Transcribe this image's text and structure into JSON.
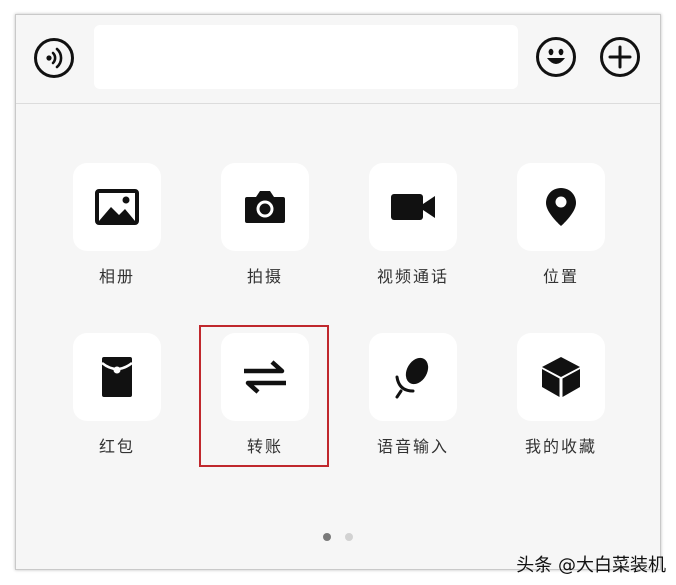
{
  "input": {
    "placeholder": ""
  },
  "actions": [
    {
      "label": "相册",
      "icon": "photo-album-icon"
    },
    {
      "label": "拍摄",
      "icon": "camera-icon"
    },
    {
      "label": "视频通话",
      "icon": "video-call-icon"
    },
    {
      "label": "位置",
      "icon": "location-pin-icon"
    },
    {
      "label": "红包",
      "icon": "red-packet-icon"
    },
    {
      "label": "转账",
      "icon": "transfer-icon"
    },
    {
      "label": "语音输入",
      "icon": "microphone-icon"
    },
    {
      "label": "我的收藏",
      "icon": "favorites-box-icon"
    }
  ],
  "pager": {
    "pages": 2,
    "current": 1
  },
  "watermark": "头条 @大白菜装机",
  "colors": {
    "highlight": "#c0282d",
    "tile": "#ffffff",
    "panel": "#f6f6f6",
    "icon": "#111111",
    "dot_active": "#7a7a7a",
    "dot_inactive": "#d2d2d2"
  }
}
